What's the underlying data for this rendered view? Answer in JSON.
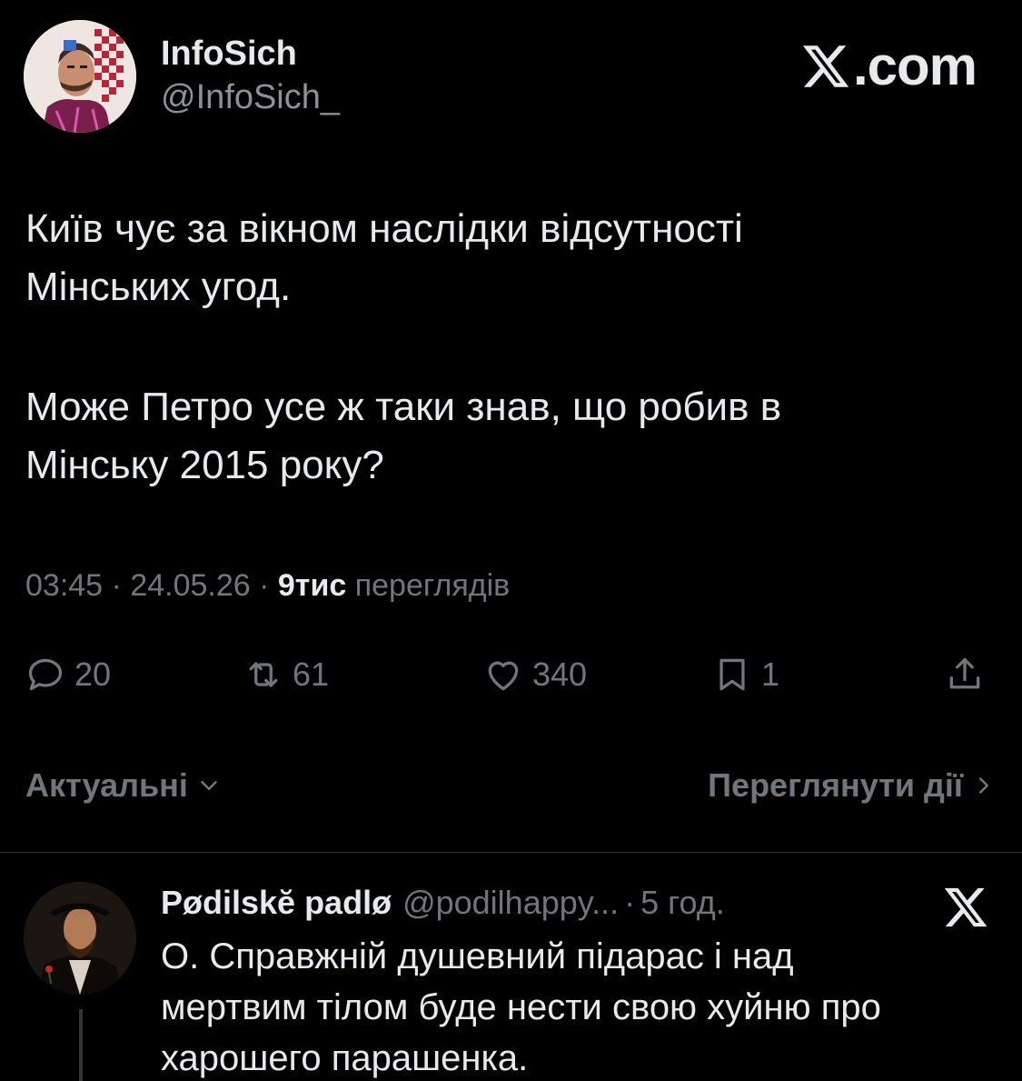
{
  "author": {
    "name": "InfoSich",
    "handle": "@InfoSich_"
  },
  "brand": {
    "label": ".com"
  },
  "tweet": {
    "paragraph1_line1": "Київ чує за вікном наслідки відсутності",
    "paragraph1_line2": "Мінських угод.",
    "paragraph2_line1": "Може Петро усе ж таки знав, що робив в",
    "paragraph2_line2": "Мінську 2015 року?"
  },
  "meta": {
    "time": "03:45",
    "sep1": " · ",
    "date": "24.05.26",
    "sep2": " · ",
    "views": "9тис",
    "views_label": " переглядів"
  },
  "actions": {
    "replies": "20",
    "reposts": "61",
    "likes": "340",
    "bookmarks": "1"
  },
  "sort": {
    "relevance": "Актуальні",
    "view_activity": "Переглянути дії"
  },
  "reply": {
    "name": "Pødilskĕ padlø",
    "handle": "@podilhappy...",
    "dot": "·",
    "time": "5 год.",
    "line1": "О. Справжній душевний підарас і над",
    "line2": "мертвим тілом буде нести свою хуйню про",
    "line3": "харошего парашенка."
  },
  "colors": {
    "background": "#000000",
    "text": "#e7e9ea",
    "muted": "#71767b"
  },
  "icons": [
    "x-logo-icon",
    "reply-icon",
    "repost-icon",
    "like-icon",
    "bookmark-icon",
    "share-icon",
    "chevron-down-icon",
    "chevron-right-icon"
  ]
}
